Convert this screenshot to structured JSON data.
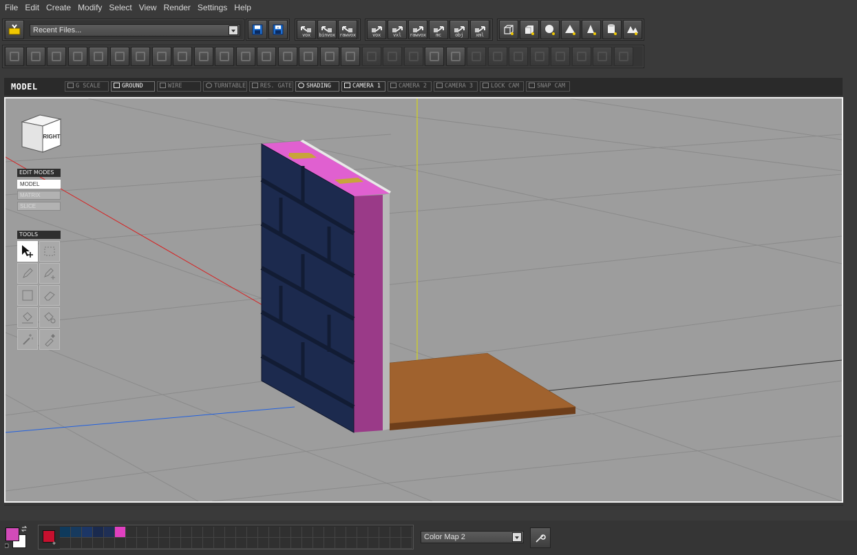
{
  "menu": [
    "File",
    "Edit",
    "Create",
    "Modify",
    "Select",
    "View",
    "Render",
    "Settings",
    "Help"
  ],
  "toolbar": {
    "recent_files": "Recent Files...",
    "export_buttons": [
      "vox",
      "binvox",
      "rawvox"
    ],
    "import_buttons": [
      "vox",
      "vxl",
      "rawvox",
      "mc",
      "obj",
      "xml"
    ],
    "primitive_icons": [
      "cube-outline-icon",
      "box-icon",
      "sphere-icon",
      "cone-icon",
      "pyramid-icon",
      "cylinder-icon",
      "mountains-icon"
    ]
  },
  "viewport": {
    "title": "MODEL",
    "toggles": [
      {
        "label": "G SCALE",
        "on": false
      },
      {
        "label": "GROUND",
        "on": true
      },
      {
        "label": "WIRE",
        "on": false
      },
      {
        "label": "TURNTABLE",
        "on": false
      },
      {
        "label": "RES. GATE",
        "on": false
      },
      {
        "label": "SHADING",
        "on": true
      },
      {
        "label": "CAMERA 1",
        "on": true
      },
      {
        "label": "CAMERA 2",
        "on": false
      },
      {
        "label": "CAMERA 3",
        "on": false
      },
      {
        "label": "LOCK CAM",
        "on": false
      },
      {
        "label": "SNAP CAM",
        "on": false
      }
    ],
    "view_cube_label": "RIGHT",
    "edit_modes_header": "EDIT MODES",
    "edit_modes": [
      {
        "label": "MODEL",
        "on": true
      },
      {
        "label": "MATRIX",
        "on": false
      },
      {
        "label": "SLICE",
        "on": false
      }
    ],
    "tools_header": "TOOLS",
    "tools": [
      "select-move-icon",
      "marquee-select-icon",
      "pencil-icon",
      "pencil-add-icon",
      "box-draw-icon",
      "eraser-icon",
      "fill-bucket-icon",
      "fill-bucket-alt-icon",
      "magic-wand-icon",
      "eyedropper-icon"
    ]
  },
  "colors": {
    "primary": "#d24bb8",
    "secondary": "#ffffff",
    "current": "#c8102e",
    "palette": [
      "#0f3a5c",
      "#173a5e",
      "#1c3666",
      "#1a2a4e",
      "#1f2f55",
      "#e040c0"
    ]
  },
  "color_map": "Color Map 2"
}
